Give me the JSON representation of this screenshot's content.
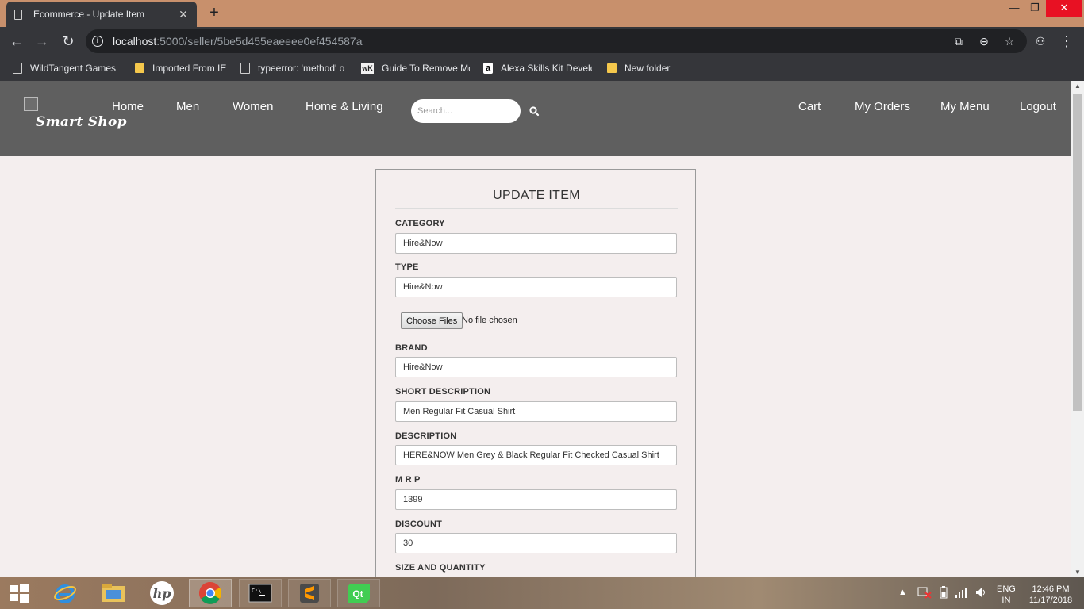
{
  "browser": {
    "tab_title": "Ecommerce - Update Item",
    "url_host": "localhost",
    "url_rest": ":5000/seller/5be5d455eaeeee0ef454587a",
    "bookmarks": [
      {
        "label": "WildTangent Games",
        "icon": "page-icon"
      },
      {
        "label": "Imported From IE",
        "icon": "folder-icon"
      },
      {
        "label": "typeerror: 'method' o",
        "icon": "page-icon"
      },
      {
        "label": "Guide To Remove Mc",
        "icon": "wk-icon"
      },
      {
        "label": "Alexa Skills Kit Develc",
        "icon": "amazon-icon"
      },
      {
        "label": "New folder",
        "icon": "folder-icon"
      }
    ]
  },
  "site": {
    "logo_text": "Smart Shop",
    "nav_left": [
      "Home",
      "Men",
      "Women",
      "Home & Living"
    ],
    "search_placeholder": "Search...",
    "nav_right": [
      "Cart",
      "My Orders",
      "My Menu",
      "Logout"
    ]
  },
  "form": {
    "title": "UPDATE ITEM",
    "category_label": "CATEGORY",
    "category_value": "Hire&Now",
    "type_label": "TYPE",
    "type_value": "Hire&Now",
    "file_button": "Choose Files",
    "file_status": "No file chosen",
    "brand_label": "BRAND",
    "brand_value": "Hire&Now",
    "short_desc_label": "SHORT DESCRIPTION",
    "short_desc_value": "Men Regular Fit Casual Shirt",
    "desc_label": "DESCRIPTION",
    "desc_value": "HERE&NOW Men Grey & Black Regular Fit Checked Casual Shirt",
    "mrp_label": "M R P",
    "mrp_value": "1399",
    "discount_label": "DISCOUNT",
    "discount_value": "30",
    "size_qty_label": "SIZE AND QUANTITY"
  },
  "taskbar": {
    "lang": "ENG",
    "region": "IN",
    "time": "12:46 PM",
    "date": "11/17/2018"
  },
  "colors": {
    "header_bg": "#5f5f5f",
    "page_bg": "#f4eeee",
    "chrome_dark": "#35363a",
    "titlebar": "#c8906c"
  }
}
